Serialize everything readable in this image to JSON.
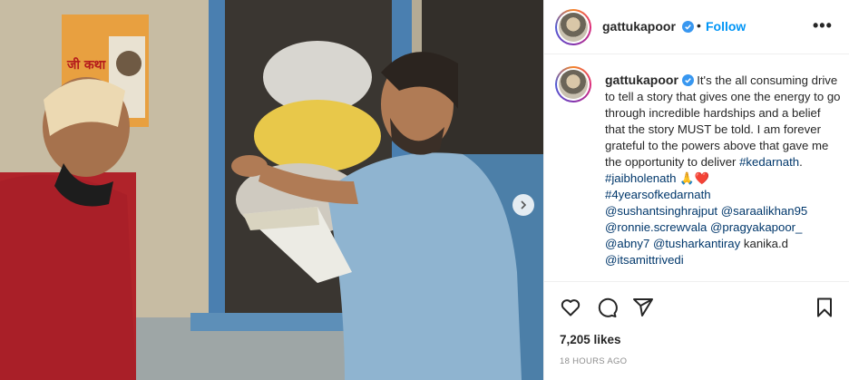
{
  "post": {
    "username": "gattukapoor",
    "follow_label": "Follow",
    "separator": "•",
    "more_label": "•••",
    "caption_text": " It's the all consuming drive to tell a story that gives one the energy to go through incredible hardships and a belief that the story MUST be told. I am forever grateful to the powers above that gave me the opportunity to deliver ",
    "hashtag_1": "#kedarnath",
    "caption_after_hashtag_1": ".",
    "hashtag_2": "#jaibholenath",
    "emojis": " 🙏❤️",
    "hashtag_3": "#4yearsofkedarnath",
    "mention_1": "@sushantsinghrajput",
    "mention_2": "@saraalikhan95",
    "mention_3": "@ronnie.screwvala",
    "mention_4": "@pragyakapoor_",
    "mention_5": "@abny7",
    "mention_6": "@tusharkantiray",
    "plain_name": "kanika.d",
    "mention_7": "@itsamittrivedi",
    "likes": "7,205 likes",
    "timestamp": "18 HOURS AGO",
    "poster_text": "जी कथा"
  },
  "colors": {
    "link": "#0095f6",
    "tag": "#00376b",
    "verified": "#3897f0",
    "text": "#262626",
    "muted": "#8e8e8e"
  },
  "icons": [
    "heart-icon",
    "comment-icon",
    "share-icon",
    "bookmark-icon",
    "verified-icon",
    "chevron-right-icon"
  ]
}
